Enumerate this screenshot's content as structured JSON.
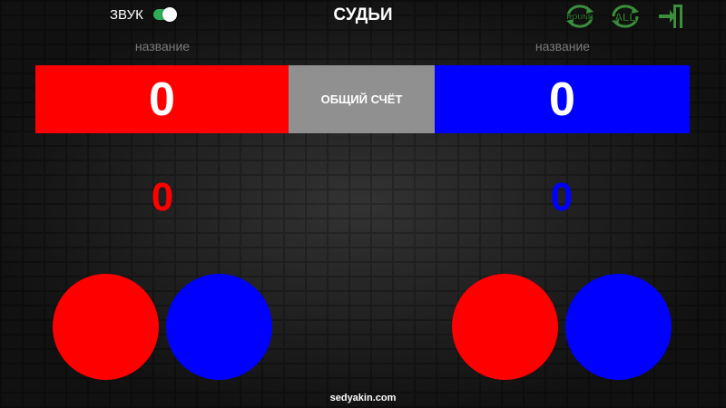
{
  "header": {
    "sound_label": "ЗВУК",
    "sound_on": true,
    "title": "СУДЬИ",
    "round_icon_text": "ROUND",
    "all_icon_text": "ALL"
  },
  "teams": {
    "left_name": "название",
    "right_name": "название"
  },
  "scoreboard": {
    "left_total": "0",
    "center_label": "ОБЩИЙ СЧЁТ",
    "right_total": "0"
  },
  "judges": {
    "left_score": "0",
    "right_score": "0"
  },
  "footer": {
    "site": "sedyakin.com"
  },
  "colors": {
    "red": "#ff0000",
    "blue": "#0000ff",
    "center_gray": "#909090",
    "icon_green": "#3a8f3a",
    "toggle_green": "#2fae58"
  }
}
